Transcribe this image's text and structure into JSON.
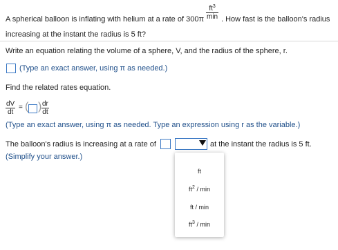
{
  "question": {
    "line1_before": "A spherical balloon is inflating with helium at a rate of 300",
    "pi": "π",
    "rate_unit_num": "ft",
    "rate_unit_num_sup": "3",
    "rate_unit_den": "min",
    "line1_after": ". How fast is the balloon's radius",
    "line2": "increasing at the instant the radius is 5 ft?"
  },
  "part1": {
    "prompt": "Write an equation relating the volume of a sphere, V, and the radius of the sphere, r.",
    "hint": "(Type an exact answer, using π as needed.)"
  },
  "part2": {
    "prompt": "Find the related rates equation.",
    "dV_num": "dV",
    "dV_den": "dt",
    "equals": "=",
    "dr_num": "dr",
    "dr_den": "dt",
    "hint": "(Type an exact answer, using π as needed. Type an expression using r as the variable.)"
  },
  "part3": {
    "before": "The balloon's radius is increasing at a rate of",
    "after": "at the instant the radius is 5 ft.",
    "hint": "(Simplify your answer.)"
  },
  "dropdown": {
    "selected": "",
    "options": [
      {
        "base": "ft",
        "sup": "",
        "rest": ""
      },
      {
        "base": "ft",
        "sup": "2",
        "rest": " / min"
      },
      {
        "base": "ft",
        "sup": "",
        "rest": " / min"
      },
      {
        "base": "ft",
        "sup": "3",
        "rest": " / min"
      }
    ]
  }
}
